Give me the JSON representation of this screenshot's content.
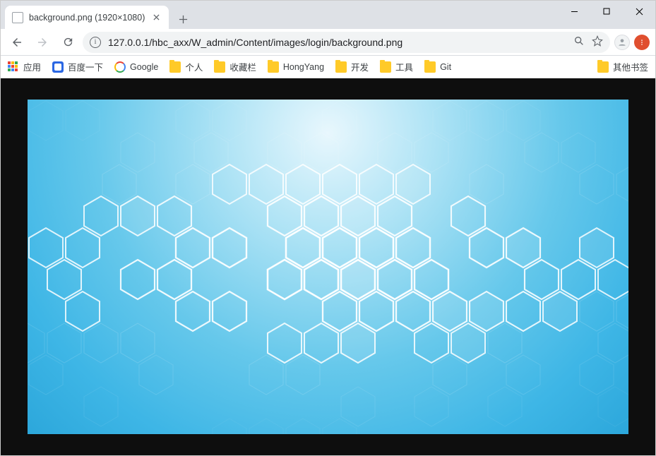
{
  "tab": {
    "title": "background.png (1920×1080)"
  },
  "omnibox": {
    "url": "127.0.0.1/hbc_axx/W_admin/Content/images/login/background.png"
  },
  "bookmarks": {
    "apps_label": "应用",
    "items": [
      {
        "label": "百度一下",
        "icon": "baidu"
      },
      {
        "label": "Google",
        "icon": "google"
      },
      {
        "label": "个人",
        "icon": "folder"
      },
      {
        "label": "收藏栏",
        "icon": "folder"
      },
      {
        "label": "HongYang",
        "icon": "folder"
      },
      {
        "label": "开发",
        "icon": "folder"
      },
      {
        "label": "工具",
        "icon": "folder"
      },
      {
        "label": "Git",
        "icon": "folder"
      }
    ],
    "overflow_label": "其他书签"
  }
}
